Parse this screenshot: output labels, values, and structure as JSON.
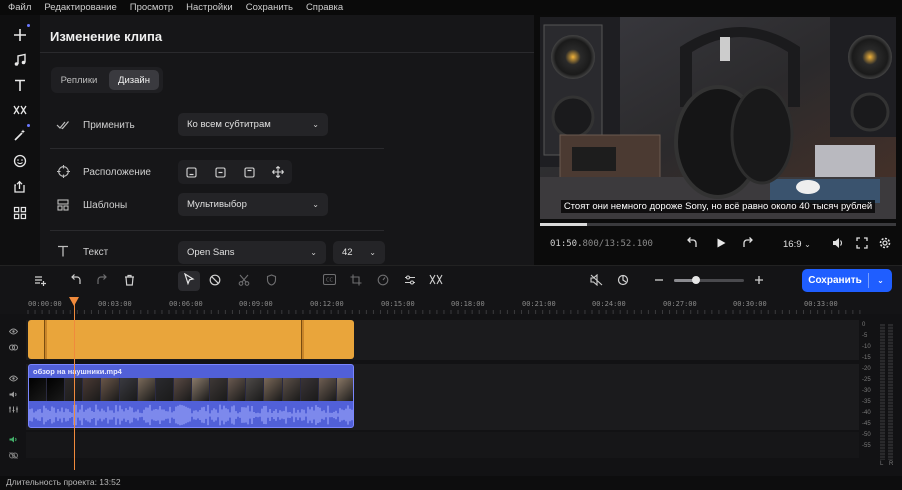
{
  "menu": [
    "Файл",
    "Редактирование",
    "Просмотр",
    "Настройки",
    "Сохранить",
    "Справка"
  ],
  "toolbar": {
    "icons": [
      "plus-icon",
      "music-note-icon",
      "text-icon",
      "transition-icon",
      "effects-wand-icon",
      "sticker-smile-icon",
      "export-share-icon",
      "widgets-grid-icon"
    ]
  },
  "edit_panel": {
    "title": "Изменение клипа",
    "tabs": [
      {
        "label": "Реплики",
        "active": false
      },
      {
        "label": "Дизайн",
        "active": true
      }
    ],
    "apply": {
      "label": "Применить",
      "value": "Ко всем субтитрам"
    },
    "position": {
      "label": "Расположение",
      "buttons": [
        "align-bottom-icon",
        "align-center-icon",
        "align-top-icon",
        "move-icon"
      ]
    },
    "templates": {
      "label": "Шаблоны",
      "value": "Мультивыбор"
    },
    "text": {
      "label": "Текст",
      "font": "Open Sans",
      "size": "42"
    }
  },
  "preview": {
    "subtitle": "Стоят они немного дороже Sony, но всё равно около 40 тысяч рублей",
    "current_time": "01:50.",
    "current_ms": "800",
    "total_time": "/13:52.100",
    "progress": 0.133,
    "aspect": "16:9"
  },
  "timeline": {
    "save_label": "Сохранить",
    "zoom": 0.31,
    "ruler_ticks": [
      "00:00:00",
      "00:03:00",
      "00:06:00",
      "00:09:00",
      "00:12:00",
      "00:15:00",
      "00:18:00",
      "00:21:00",
      "00:24:00",
      "00:27:00",
      "00:30:00",
      "00:33:00"
    ],
    "clip_name": "обзор на наушники.mp4",
    "meter_labels": [
      "0",
      "-5",
      "-10",
      "-15",
      "-20",
      "-25",
      "-30",
      "-35",
      "-40",
      "-45",
      "-50",
      "-55"
    ],
    "meter_channels": [
      "L",
      "R"
    ]
  },
  "status": {
    "duration": "Длительность проекта: 13:52"
  },
  "colors": {
    "accent": "#1f5eff",
    "subtitle_clip": "#e9a53b",
    "video_clip": "#5160d8",
    "playhead": "#f08a3c"
  }
}
